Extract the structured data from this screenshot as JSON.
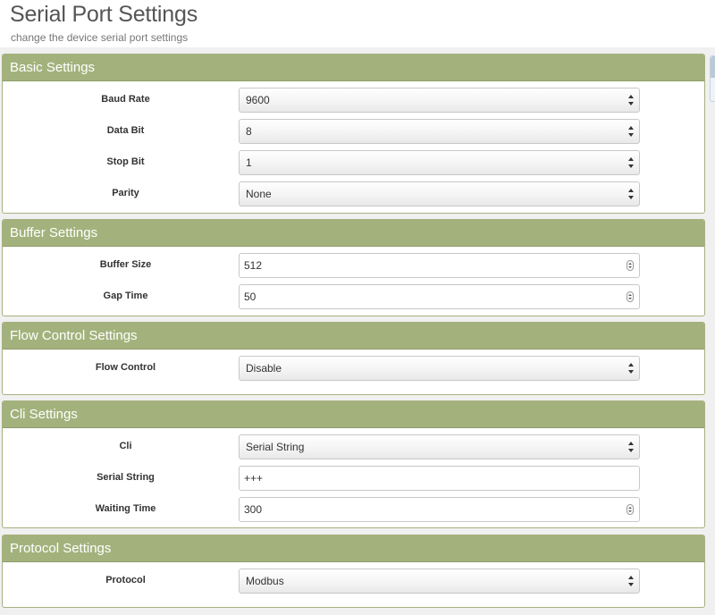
{
  "page": {
    "title": "Serial Port Settings",
    "subtitle": "change the device serial port settings"
  },
  "sections": {
    "basic": {
      "title": "Basic Settings",
      "baud_rate": {
        "label": "Baud Rate",
        "value": "9600"
      },
      "data_bit": {
        "label": "Data Bit",
        "value": "8"
      },
      "stop_bit": {
        "label": "Stop Bit",
        "value": "1"
      },
      "parity": {
        "label": "Parity",
        "value": "None"
      }
    },
    "buffer": {
      "title": "Buffer Settings",
      "buffer_size": {
        "label": "Buffer Size",
        "value": "512"
      },
      "gap_time": {
        "label": "Gap Time",
        "value": "50"
      }
    },
    "flow": {
      "title": "Flow Control Settings",
      "flow_control": {
        "label": "Flow Control",
        "value": "Disable"
      }
    },
    "cli": {
      "title": "Cli Settings",
      "cli": {
        "label": "Cli",
        "value": "Serial String"
      },
      "serial_string": {
        "label": "Serial String",
        "value": "+++"
      },
      "waiting_time": {
        "label": "Waiting Time",
        "value": "300"
      }
    },
    "protocol": {
      "title": "Protocol Settings",
      "protocol": {
        "label": "Protocol",
        "value": "Modbus"
      }
    }
  },
  "icons": {
    "select_arrows": "up-down-caret-icon",
    "number_spinner": "spinner-icon"
  },
  "colors": {
    "panel_header": "#a3b27c",
    "panel_border": "#a6b17f",
    "background": "#f0f0f0"
  }
}
